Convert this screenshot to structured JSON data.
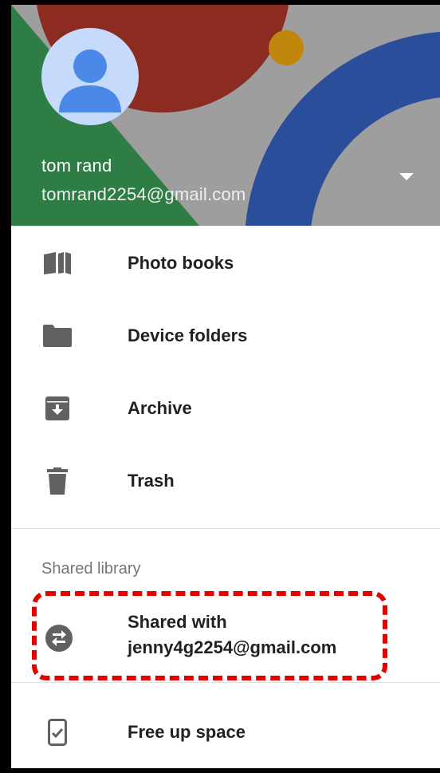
{
  "account": {
    "name": "tom rand",
    "email": "tomrand2254@gmail.com"
  },
  "menu": {
    "items": [
      {
        "label": "Photo books",
        "icon": "photo-book-icon"
      },
      {
        "label": "Device folders",
        "icon": "folder-icon"
      },
      {
        "label": "Archive",
        "icon": "archive-icon"
      },
      {
        "label": "Trash",
        "icon": "trash-icon"
      }
    ]
  },
  "shared_library": {
    "title": "Shared library",
    "item": {
      "line1": "Shared with",
      "line2": "jenny4g2254@gmail.com",
      "icon": "share-swap-icon"
    }
  },
  "footer_item": {
    "label": "Free up space",
    "icon": "phone-check-icon"
  },
  "colors": {
    "header_green": "#2e7d45",
    "header_red": "#8c2b22",
    "header_blue": "#2b4e9a",
    "header_gold": "#c0870c",
    "header_gray": "#9e9e9e",
    "avatar_bg": "#c6dafc",
    "avatar_fg": "#4a89e8",
    "highlight": "#e50000"
  }
}
